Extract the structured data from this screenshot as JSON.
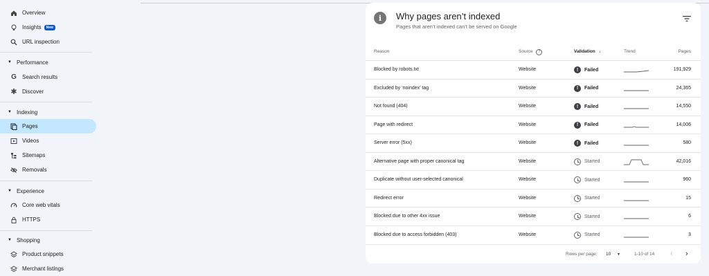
{
  "sidebar": {
    "top_items": [
      {
        "label": "Overview",
        "icon": "home-icon"
      },
      {
        "label": "Insights",
        "icon": "lightbulb-icon",
        "badge": "New"
      },
      {
        "label": "URL inspection",
        "icon": "search-icon"
      }
    ],
    "sections": [
      {
        "title": "Performance",
        "items": [
          {
            "label": "Search results",
            "icon": "google-g-icon"
          },
          {
            "label": "Discover",
            "icon": "asterisk-icon"
          }
        ]
      },
      {
        "title": "Indexing",
        "items": [
          {
            "label": "Pages",
            "icon": "pages-icon"
          },
          {
            "label": "Videos",
            "icon": "video-icon"
          },
          {
            "label": "Sitemaps",
            "icon": "sitemap-icon"
          },
          {
            "label": "Removals",
            "icon": "eye-off-icon"
          }
        ]
      },
      {
        "title": "Experience",
        "items": [
          {
            "label": "Core web vitals",
            "icon": "gauge-icon"
          },
          {
            "label": "HTTPS",
            "icon": "lock-icon"
          }
        ]
      },
      {
        "title": "Shopping",
        "items": [
          {
            "label": "Product snippets",
            "icon": "layers-icon"
          },
          {
            "label": "Merchant listings",
            "icon": "layers-icon"
          }
        ]
      }
    ],
    "active_item": "Pages",
    "active_color": "#c2e7ff"
  },
  "card": {
    "title": "Why pages aren’t indexed",
    "subtitle": "Pages that aren’t indexed can’t be served on Google",
    "columns": {
      "reason": "Reason",
      "source": "Source",
      "validation": "Validation",
      "trend": "Trend",
      "pages": "Pages"
    },
    "rows": [
      {
        "reason": "Blocked by robots.txt",
        "source": "Website",
        "validation": "Failed",
        "status": "failed",
        "trend": "rising",
        "pages": "191,929"
      },
      {
        "reason": "Excluded by ‘noindex’ tag",
        "source": "Website",
        "validation": "Failed",
        "status": "failed",
        "trend": "flat",
        "pages": "24,365"
      },
      {
        "reason": "Not found (404)",
        "source": "Website",
        "validation": "Failed",
        "status": "failed",
        "trend": "flat",
        "pages": "14,550"
      },
      {
        "reason": "Page with redirect",
        "source": "Website",
        "validation": "Failed",
        "status": "failed",
        "trend": "flat-bump",
        "pages": "14,006"
      },
      {
        "reason": "Server error (5xx)",
        "source": "Website",
        "validation": "Failed",
        "status": "failed",
        "trend": "flat",
        "pages": "580"
      },
      {
        "reason": "Alternative page with proper canonical tag",
        "source": "Website",
        "validation": "Started",
        "status": "started",
        "trend": "plateau",
        "pages": "42,016"
      },
      {
        "reason": "Duplicate without user-selected canonical",
        "source": "Website",
        "validation": "Started",
        "status": "started",
        "trend": "flat",
        "pages": "960"
      },
      {
        "reason": "Redirect error",
        "source": "Website",
        "validation": "Started",
        "status": "started",
        "trend": "flat",
        "pages": "15"
      },
      {
        "reason": "Blocked due to other 4xx issue",
        "source": "Website",
        "validation": "Started",
        "status": "started",
        "trend": "flat",
        "pages": "6"
      },
      {
        "reason": "Blocked due to access forbidden (403)",
        "source": "Website",
        "validation": "Started",
        "status": "started",
        "trend": "flat",
        "pages": "3"
      }
    ],
    "footer": {
      "rows_per_page_label": "Rows per page:",
      "rows_per_page_value": "10",
      "range": "1-10 of 14"
    }
  }
}
